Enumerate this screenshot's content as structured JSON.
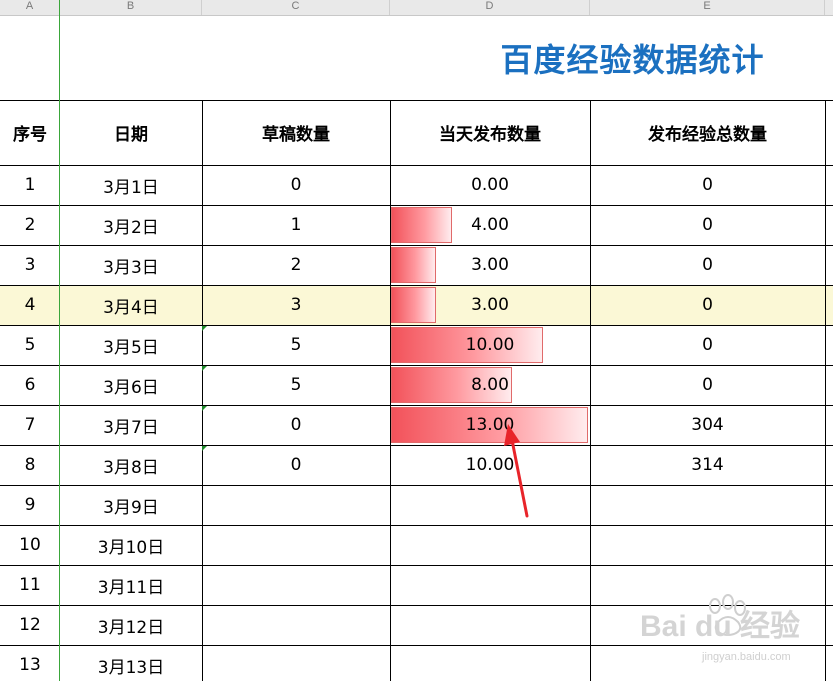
{
  "columns": [
    "A",
    "B",
    "C",
    "D",
    "E"
  ],
  "title": "百度经验数据统计",
  "headers": {
    "seq": "序号",
    "date": "日期",
    "drafts": "草稿数量",
    "daily": "当天发布数量",
    "total": "发布经验总数量"
  },
  "rows": [
    {
      "seq": "1",
      "date": "3月1日",
      "drafts": "0",
      "daily": "0.00",
      "daily_value": 0,
      "total": "0"
    },
    {
      "seq": "2",
      "date": "3月2日",
      "drafts": "1",
      "daily": "4.00",
      "daily_value": 4,
      "total": "0"
    },
    {
      "seq": "3",
      "date": "3月3日",
      "drafts": "2",
      "daily": "3.00",
      "daily_value": 3,
      "total": "0"
    },
    {
      "seq": "4",
      "date": "3月4日",
      "drafts": "3",
      "daily": "3.00",
      "daily_value": 3,
      "total": "0"
    },
    {
      "seq": "5",
      "date": "3月5日",
      "drafts": "5",
      "daily": "10.00",
      "daily_value": 10,
      "total": "0"
    },
    {
      "seq": "6",
      "date": "3月6日",
      "drafts": "5",
      "daily": "8.00",
      "daily_value": 8,
      "total": "0"
    },
    {
      "seq": "7",
      "date": "3月7日",
      "drafts": "0",
      "daily": "13.00",
      "daily_value": 13,
      "total": "304"
    },
    {
      "seq": "8",
      "date": "3月8日",
      "drafts": "0",
      "daily": "10.00",
      "daily_value": null,
      "total": "314"
    },
    {
      "seq": "9",
      "date": "3月9日",
      "drafts": "",
      "daily": "",
      "daily_value": null,
      "total": ""
    },
    {
      "seq": "10",
      "date": "3月10日",
      "drafts": "",
      "daily": "",
      "daily_value": null,
      "total": ""
    },
    {
      "seq": "11",
      "date": "3月11日",
      "drafts": "",
      "daily": "",
      "daily_value": null,
      "total": ""
    },
    {
      "seq": "12",
      "date": "3月12日",
      "drafts": "",
      "daily": "",
      "daily_value": null,
      "total": ""
    },
    {
      "seq": "13",
      "date": "3月13日",
      "drafts": "",
      "daily": "",
      "daily_value": null,
      "total": ""
    }
  ],
  "databar_max": 13,
  "highlighted_row": 3,
  "colors": {
    "title": "#1b70c0",
    "highlight": "#fbf8d6",
    "bar_start": "#f2525a",
    "bar_end": "#ffecee",
    "annotation_arrow": "#e8242a"
  },
  "watermark": {
    "brand": "Bai du 经验",
    "url": "jingyan.baidu.com"
  }
}
